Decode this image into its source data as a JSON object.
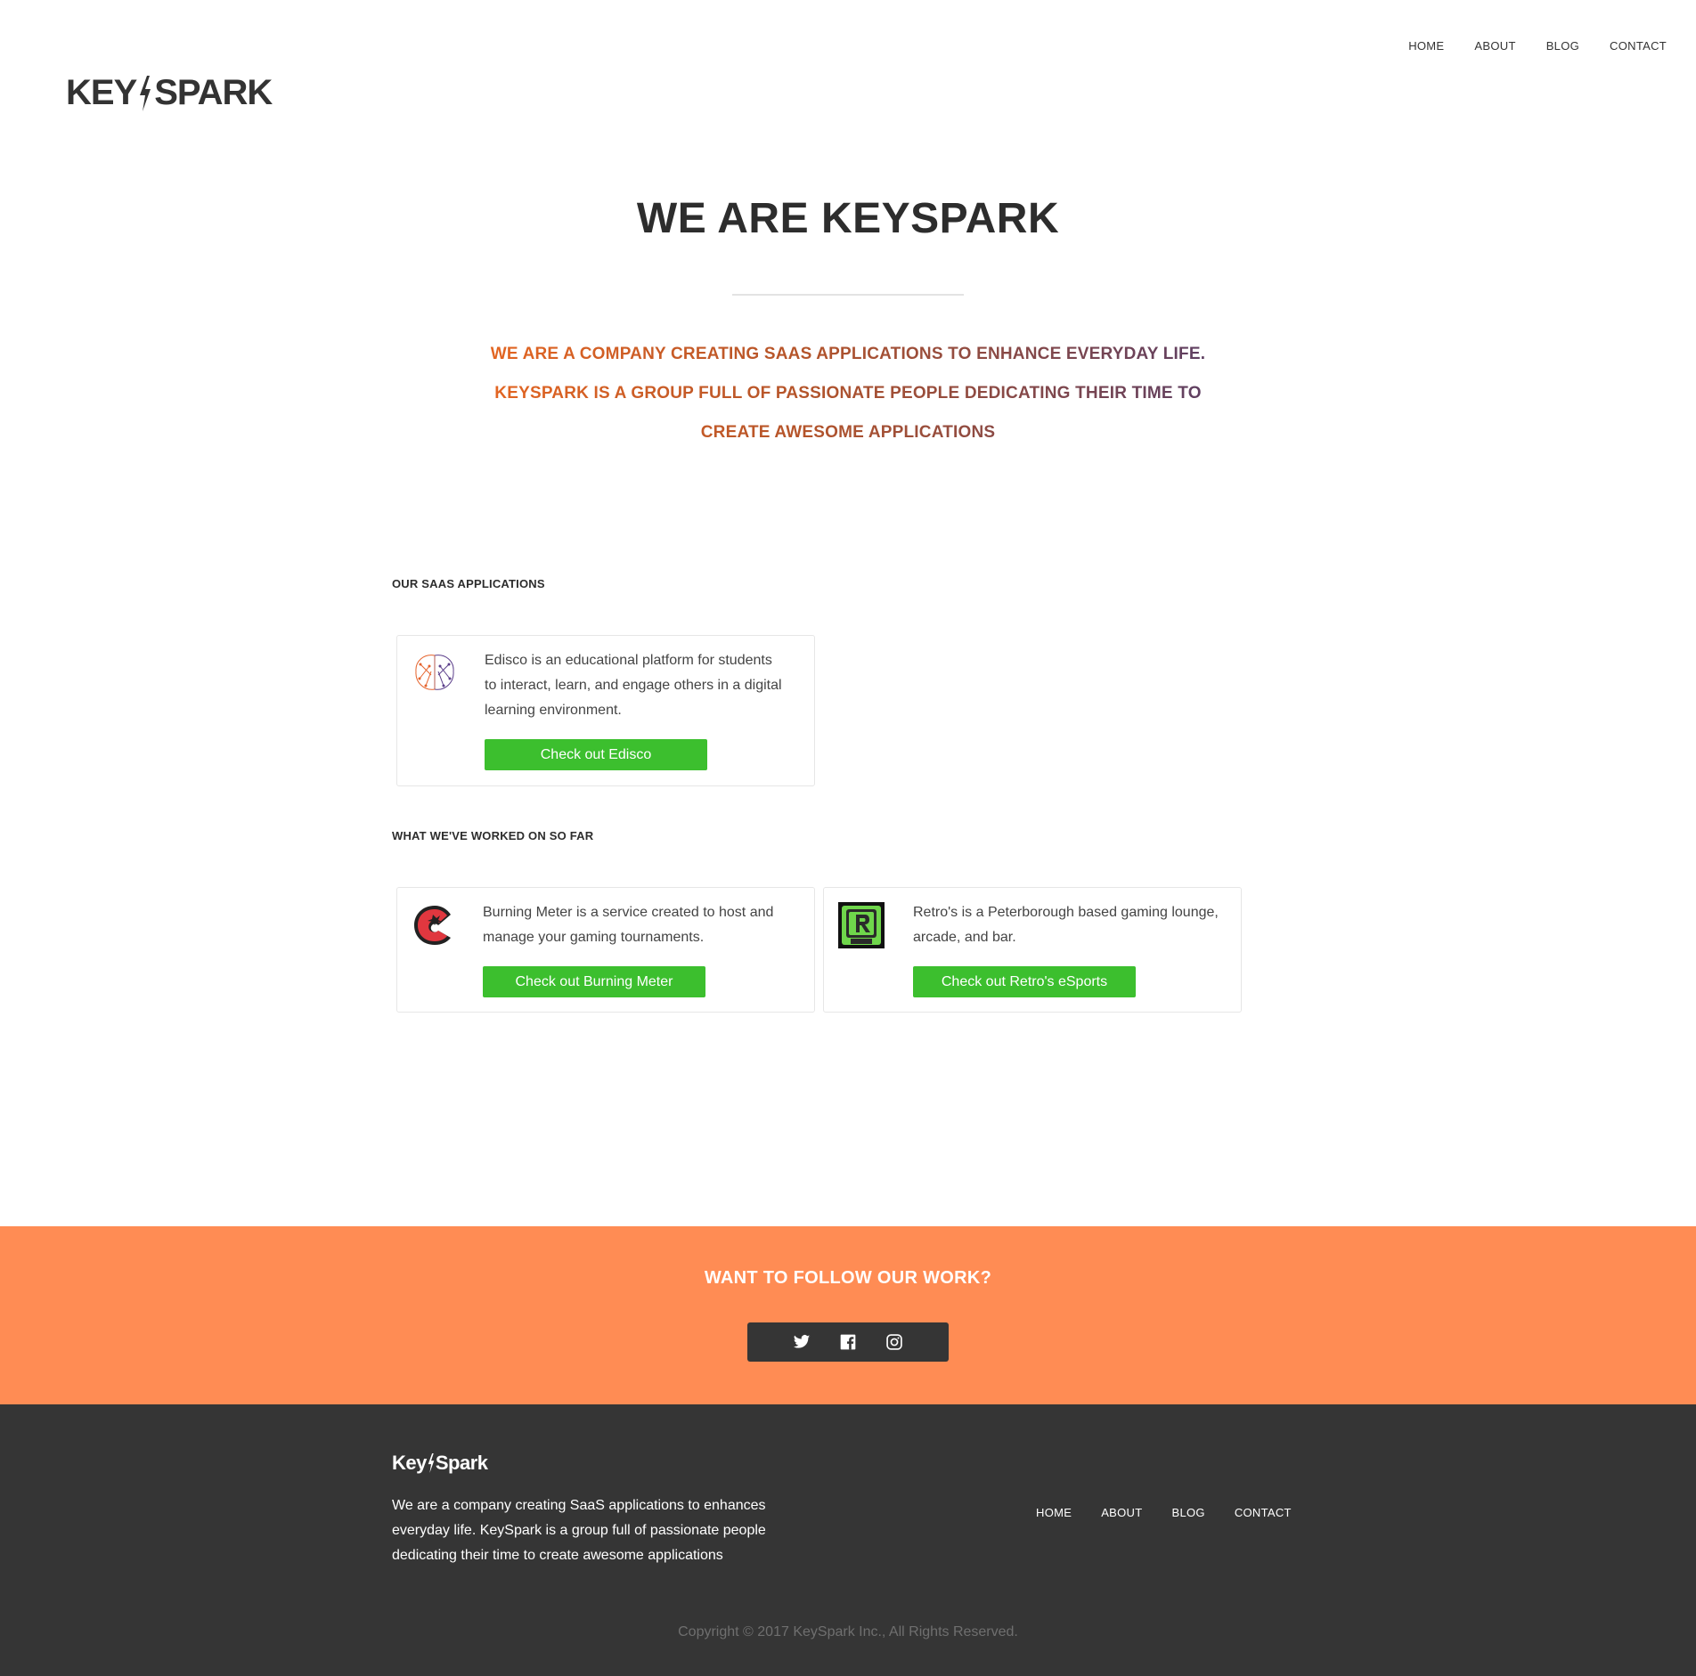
{
  "nav": {
    "home": "HOME",
    "about": "ABOUT",
    "blog": "BLOG",
    "contact": "CONTACT"
  },
  "brand": {
    "key": "KEY",
    "spark": "SPARK",
    "footer_key": "Key",
    "footer_spark": "Spark"
  },
  "hero": {
    "title": "WE ARE KEYSPARK",
    "tagline": [
      "WE ARE A COMPANY CREATING SAAS APPLICATIONS TO ENHANCE EVERYDAY LIFE.",
      "KEYSPARK IS A GROUP FULL OF PASSIONATE PEOPLE DEDICATING THEIR TIME TO",
      "CREATE AWESOME APPLICATIONS"
    ]
  },
  "saas": {
    "heading": "OUR SAAS APPLICATIONS",
    "cards": [
      {
        "icon": "brain-icon",
        "description": "Edisco is an educational platform for students to interact, learn, and engage others in a digital learning environment.",
        "button": "Check out Edisco"
      }
    ]
  },
  "work": {
    "heading": "WHAT WE'VE WORKED ON SO FAR",
    "cards": [
      {
        "icon": "burning-meter-logo-icon",
        "description": "Burning Meter is a service created to host and manage your gaming tournaments.",
        "button": "Check out Burning Meter"
      },
      {
        "icon": "retro-logo-icon",
        "description": "Retro's is a Peterborough based gaming lounge, arcade, and bar.",
        "button": "Check out Retro's eSports"
      }
    ]
  },
  "follow": {
    "heading": "WANT TO FOLLOW OUR WORK?",
    "icons": [
      "twitter-icon",
      "facebook-icon",
      "instagram-icon"
    ]
  },
  "footer": {
    "text": "We are a company creating SaaS applications to enhances everyday life. KeySpark is a group full of passionate people dedicating their time to create awesome applications",
    "nav": {
      "home": "HOME",
      "about": "ABOUT",
      "blog": "BLOG",
      "contact": "CONTACT"
    },
    "copyright": "Copyright © 2017 KeySpark Inc., All Rights Reserved."
  },
  "colors": {
    "accent_orange": "#ff8c54",
    "button_green": "#3cbf2e",
    "dark": "#353535"
  }
}
